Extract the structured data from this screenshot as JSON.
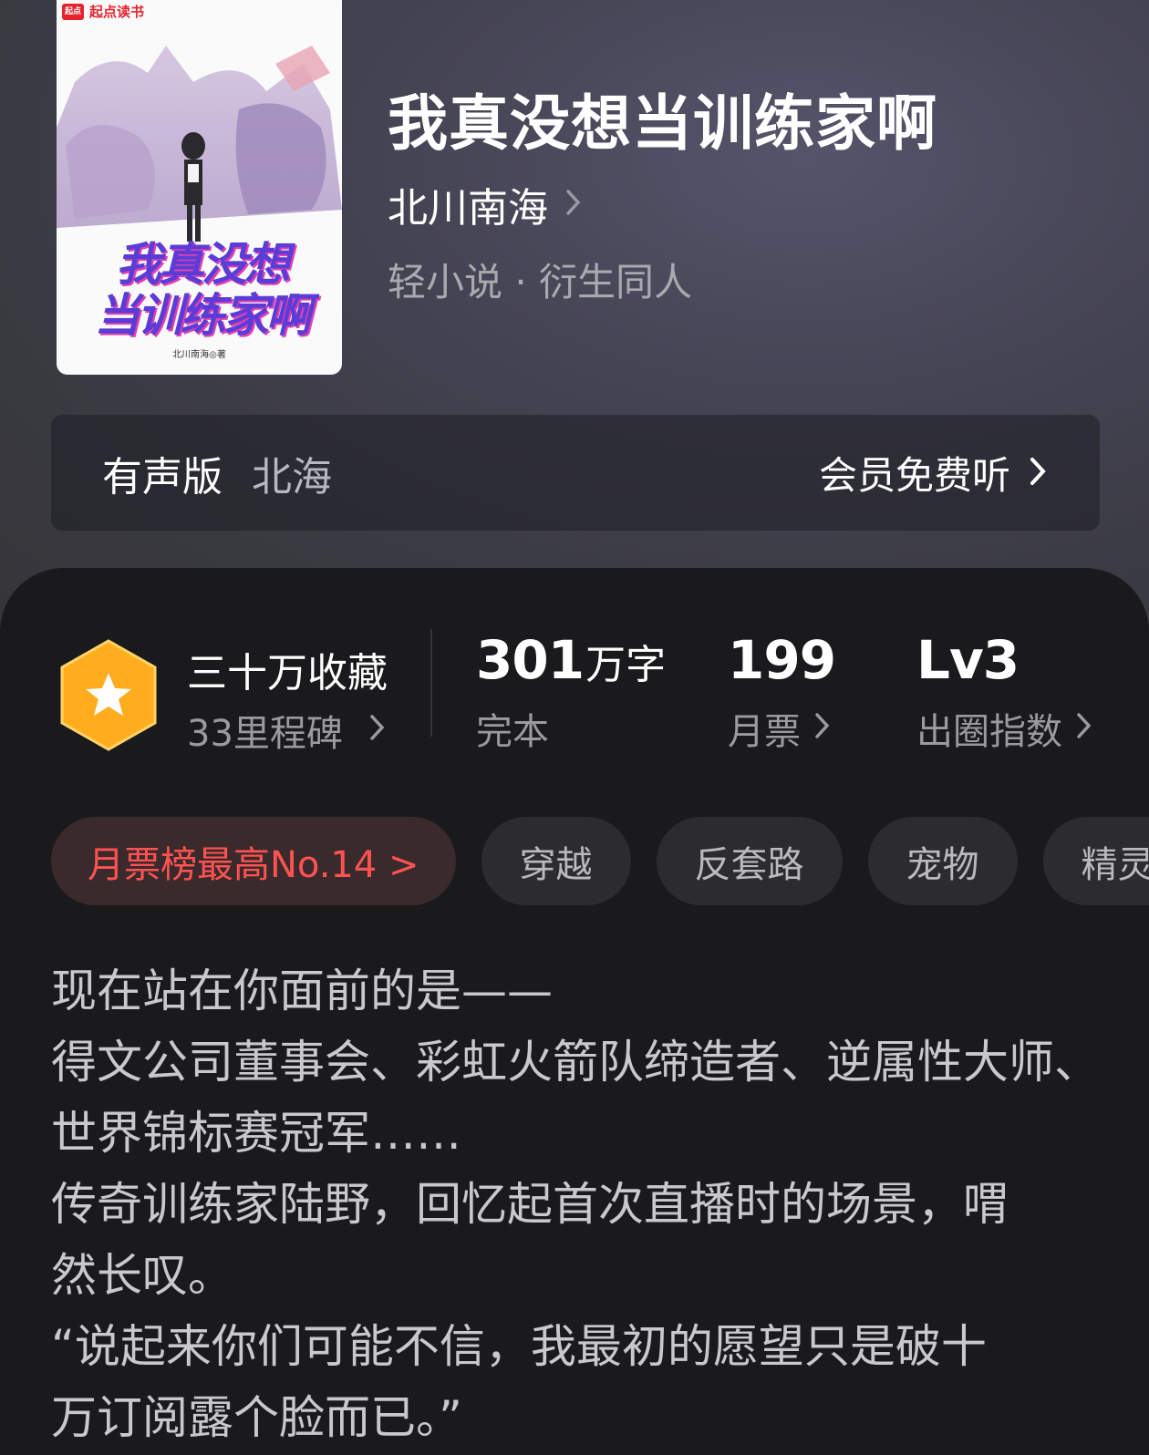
{
  "cover": {
    "brand": "起点读书",
    "brand_logo": "起点",
    "title_lines": [
      "我真没想",
      "当训练家啊"
    ],
    "author": "北川南海◎著"
  },
  "book": {
    "title": "我真没想当训练家啊",
    "author": "北川南海",
    "genre": "轻小说 · 衍生同人"
  },
  "audio": {
    "label": "有声版",
    "narrator": "北海",
    "action": "会员免费听"
  },
  "stats": {
    "collection_main": "三十万收藏",
    "collection_sub": "33里程碑",
    "words_value": "301",
    "words_unit": "万字",
    "words_sub": "完本",
    "tickets_value": "199",
    "tickets_sub": "月票",
    "level_value": "Lv3",
    "level_sub": "出圈指数"
  },
  "tags": {
    "rank": "月票榜最高No.14 >",
    "t1": "穿越",
    "t2": "反套路",
    "t3": "宠物",
    "t4": "精灵"
  },
  "description": [
    "现在站在你面前的是——",
    "得文公司董事会、彩虹火箭队缔造者、逆属性大师、",
    "世界锦标赛冠军……",
    "传奇训练家陆野，回忆起首次直播时的场景，喟",
    "然长叹。",
    "“说起来你们可能不信，我最初的愿望只是破十",
    "万订阅露个脸而已。”"
  ],
  "colors": {
    "accent_red": "#ff5252",
    "badge_orange": "#ffad1f",
    "panel_bg": "#1a1a1c"
  }
}
